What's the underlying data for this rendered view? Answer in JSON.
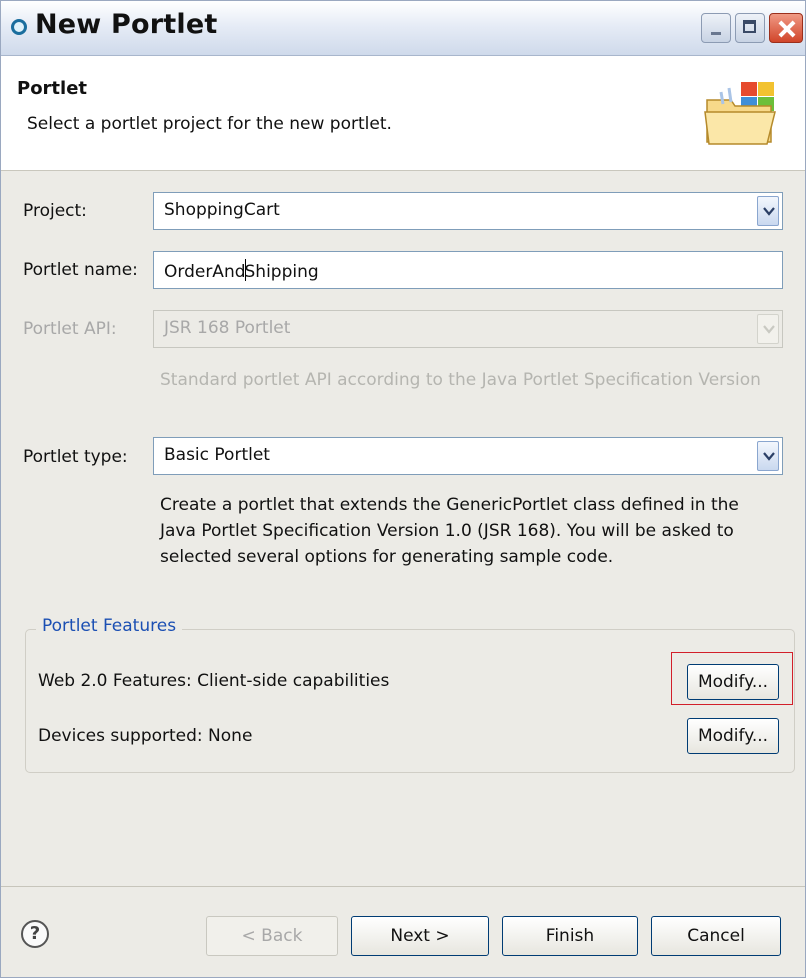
{
  "window": {
    "title": "New Portlet"
  },
  "header": {
    "title": "Portlet",
    "description": "Select a portlet project for the new portlet."
  },
  "form": {
    "project": {
      "label": "Project:",
      "value": "ShoppingCart"
    },
    "portlet_name": {
      "label": "Portlet name:",
      "value_before_caret": "OrderAnd",
      "value_after_caret": "Shipping"
    },
    "portlet_api": {
      "label": "Portlet API:",
      "value": "JSR 168 Portlet",
      "hint": "Standard portlet API according to the Java Portlet Specification Version"
    },
    "portlet_type": {
      "label": "Portlet type:",
      "value": "Basic Portlet",
      "hint_lines": [
        "Create a portlet that extends the GenericPortlet class defined in the",
        "Java Portlet Specification Version 1.0 (JSR 168).  You will be asked to",
        "selected several options for generating sample code."
      ]
    }
  },
  "features": {
    "title": "Portlet Features",
    "web20_label": "Web 2.0 Features: Client-side capabilities",
    "web20_button": "Modify...",
    "devices_label": "Devices supported: None",
    "devices_button": "Modify..."
  },
  "footer": {
    "help": "?",
    "back": "< Back",
    "next": "Next >",
    "finish": "Finish",
    "cancel": "Cancel"
  },
  "colors": {
    "group_title": "#1b4fb3",
    "highlight": "#d21f2a",
    "button_border": "#003c74",
    "close_button": "#d1452a"
  },
  "icons": {
    "title": "portlet-wizard-icon",
    "header": "folder-banner-icon",
    "dropdown": "chevron-down-icon",
    "help": "help-icon"
  }
}
